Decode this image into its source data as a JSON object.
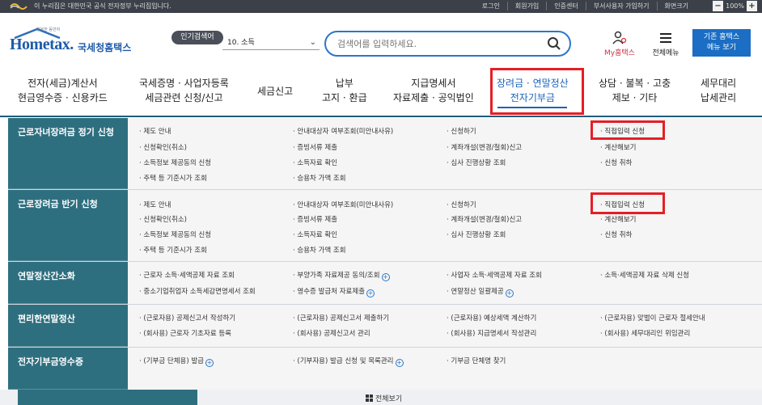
{
  "topbar": {
    "notice": "이 누리집은 대한민국 공식 전자정부 누리집입니다.",
    "links": [
      "로그인",
      "회원가입",
      "인증센터",
      "부서사용자 가입하기",
      "화면크기"
    ],
    "zoom_minus": "−",
    "zoom_value": "100%",
    "zoom_plus": "+"
  },
  "header": {
    "logo_sub": "행복한 동반자",
    "logo_text": "Hometax.",
    "logo_kr": "국세청홈택스",
    "popular_tag": "인기검색어",
    "popular_selected": "10. 소득",
    "search_placeholder": "검색어를 입력하세요.",
    "my_label": "My홈택스",
    "menu_label": "전체메뉴",
    "old_home_line1": "기존 홈택스",
    "old_home_line2": "메뉴 보기"
  },
  "gnb": [
    {
      "line1": "전자(세금)계산서",
      "line2": "현금영수증 · 신용카드"
    },
    {
      "line1": "국세증명 · 사업자등록",
      "line2": "세금관련 신청/신고"
    },
    {
      "line1": "세금신고",
      "line2": ""
    },
    {
      "line1": "납부",
      "line2": "고지 · 환급"
    },
    {
      "line1": "지급명세서",
      "line2": "자료제출 · 공익법인"
    },
    {
      "line1": "장려금 · 연말정산",
      "line2": "전자기부금"
    },
    {
      "line1": "상담 · 불복 · 고충",
      "line2": "제보 · 기타"
    },
    {
      "line1": "세무대리",
      "line2": "납세관리"
    }
  ],
  "rows": [
    {
      "category": "근로자녀장려금 정기 신청",
      "items": [
        [
          "· 제도 안내",
          "· 안내대상자 여부조회(미안내사유)",
          "· 신청하기",
          "· 직접입력 신청"
        ],
        [
          "· 신청확인(취소)",
          "· 증빙서류 제출",
          "· 계좌개설(변경/철회)신고",
          "· 계산해보기"
        ],
        [
          "· 소득정보 제공동의 신청",
          "· 소득자료 확인",
          "· 심사 진행상황 조회",
          "· 신청 취하"
        ],
        [
          "· 주택 등 기준시가 조회",
          "· 승용차 가액 조회",
          "",
          ""
        ]
      ]
    },
    {
      "category": "근로장려금 반기 신청",
      "items": [
        [
          "· 제도 안내",
          "· 안내대상자 여부조회(미안내사유)",
          "· 신청하기",
          "· 직접입력 신청"
        ],
        [
          "· 신청확인(취소)",
          "· 증빙서류 제출",
          "· 계좌개설(변경/철회)신고",
          "· 계산해보기"
        ],
        [
          "· 소득정보 제공동의 신청",
          "· 소득자료 확인",
          "· 심사 진행상황 조회",
          "· 신청 취하"
        ],
        [
          "· 주택 등 기준시가 조회",
          "· 승용차 가액 조회",
          "",
          ""
        ]
      ]
    },
    {
      "category": "연말정산간소화",
      "items": [
        [
          "· 근로자 소득·세액공제 자료 조회",
          "· 부양가족 자료제공 동의/조회",
          "· 사업자 소득·세액공제 자료 조회",
          "· 소득·세액공제 자료 삭제 신청"
        ],
        [
          "· 중소기업취업자 소득세감면명세서 조회",
          "· 영수증 발급처 자료제출",
          "· 연말정산 일괄제공",
          ""
        ]
      ]
    },
    {
      "category": "편리한연말정산",
      "items": [
        [
          "· (근로자용) 공제신고서 작성하기",
          "· (근로자용) 공제신고서 제출하기",
          "· (근로자용) 예상세액 계산하기",
          "· (근로자용) 맞벌이 근로자 절세안내"
        ],
        [
          "· (회사용) 근로자 기초자료 등록",
          "· (회사용) 공제신고서 관리",
          "· (회사용) 지급명세서 작성관리",
          "· (회사용) 세무대리인 위임관리"
        ]
      ]
    },
    {
      "category": "전자기부금영수증",
      "items": [
        [
          "· (기부금 단체용) 발급",
          "· (기부자용) 발급 신청 및 목록관리",
          "· 기부금 단체명 찾기",
          ""
        ]
      ]
    }
  ],
  "bottom": {
    "view_all": "전체보기"
  }
}
